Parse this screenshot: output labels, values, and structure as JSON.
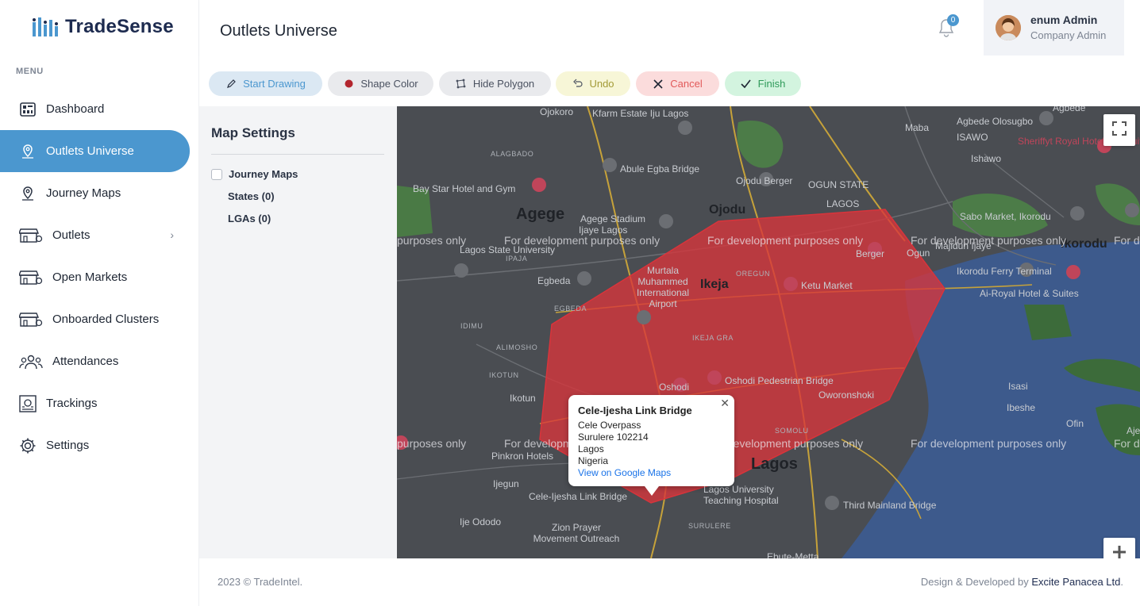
{
  "brand": {
    "name": "TradeSense"
  },
  "sidebar": {
    "menu_title": "MENU",
    "items": [
      {
        "label": "Dashboard",
        "icon": "dashboard-icon"
      },
      {
        "label": "Outlets Universe",
        "icon": "map-pin-icon",
        "active": true
      },
      {
        "label": "Journey Maps",
        "icon": "map-pin-icon"
      },
      {
        "label": "Outlets",
        "icon": "store-icon",
        "has_submenu": true
      },
      {
        "label": "Open Markets",
        "icon": "store-icon"
      },
      {
        "label": "Onboarded Clusters",
        "icon": "store-icon"
      },
      {
        "label": "Attendances",
        "icon": "people-icon"
      },
      {
        "label": "Trackings",
        "icon": "tracking-icon"
      },
      {
        "label": "Settings",
        "icon": "gear-icon"
      }
    ]
  },
  "header": {
    "title": "Outlets Universe",
    "notifications_count": "0",
    "user_name": "enum Admin",
    "user_role": "Company Admin"
  },
  "toolbar": {
    "start_drawing": "Start Drawing",
    "shape_color": "Shape Color",
    "hide_polygon": "Hide Polygon",
    "undo": "Undo",
    "cancel": "Cancel",
    "finish": "Finish"
  },
  "map_settings": {
    "title": "Map Settings",
    "journey_maps_label": "Journey Maps",
    "states_label": "States (0)",
    "lgas_label": "LGAs (0)"
  },
  "map": {
    "watermark": "For development purposes only",
    "watermark_partial_left": "purposes only",
    "watermark_partial_right": "For d",
    "polygon_color": "#d9343b",
    "labels": {
      "agege": "Agege",
      "ikeja": "Ikeja",
      "lagos": "Lagos",
      "ikorodu": "Ikorodu",
      "ojodu": "Ojodu",
      "ojokoro": "Ojokoro",
      "kfarm": "Kfarm Estate Iju Lagos",
      "abule": "Abule Egba Bridge",
      "ojodu_berger": "Ojodu Berger",
      "ogun_state": "OGUN STATE",
      "lagos_caps": "LAGOS",
      "maba": "Maba",
      "isawo": "ISAWO",
      "ishawo": "Ishawo",
      "agbede": "Agbede Olosugbo",
      "agbede2": "Agbede",
      "sheriffyt": "Sheriffyt Royal Hotel and Suites",
      "bay_star": "Bay Star Hotel and Gym",
      "alagbado": "ALAGBADO",
      "agege_stadium": "Agege Stadium",
      "ijaiye": "Ijaye Lagos",
      "sabo": "Sabo Market, Ikorodu",
      "majidun": "Majidun Ijaye",
      "ogun": "Ogun",
      "lagos_univ": "Lagos State University",
      "ipaja": "IPAJA",
      "egbeda": "Egbeda",
      "egbeda_caps": "EGBEDA",
      "murtala": "Murtala Muhammed International Airport",
      "berger": "Berger",
      "ketu": "Ketu Market",
      "oregun": "OREGUN",
      "ikorodu_ferry": "Ikorodu Ferry Terminal",
      "ai_royal": "Ai-Royal Hotel & Suites",
      "idimu": "IDIMU",
      "alimosho": "ALIMOSHO",
      "ikeja_gra": "IKEJA GRA",
      "ikotun_caps": "IKOTUN",
      "ikotun": "Ikotun",
      "oshodi": "Oshodi",
      "oshodi_bridge": "Oshodi Pedestrian Bridge",
      "oworonshoki": "Oworonshoki",
      "isasi": "Isasi",
      "ibeshe": "Ibeshe",
      "ofin": "Ofin",
      "pinkron": "Pinkron Hotels",
      "ijegun": "Ijegun",
      "cele": "Cele-Ijesha Link Bridge",
      "somolu": "SOMOLU",
      "luth": "Lagos University Teaching Hospital",
      "third": "Third Mainland Bridge",
      "ije": "Ije Ododo",
      "zion": "Zion Prayer Movement Outreach",
      "surulere": "SURULERE",
      "ebute": "Ebute-Metta",
      "aje": "Aje"
    },
    "popup": {
      "title": "Cele-Ijesha Link Bridge",
      "line1": "Cele Overpass",
      "line2": "Surulere 102214",
      "line3": "Lagos",
      "line4": "Nigeria",
      "link": "View on Google Maps"
    }
  },
  "footer": {
    "copyright": "2023 © TradeIntel.",
    "credit_prefix": "Design & Developed by ",
    "credit_company": "Excite Panacea Ltd",
    "credit_suffix": "."
  }
}
